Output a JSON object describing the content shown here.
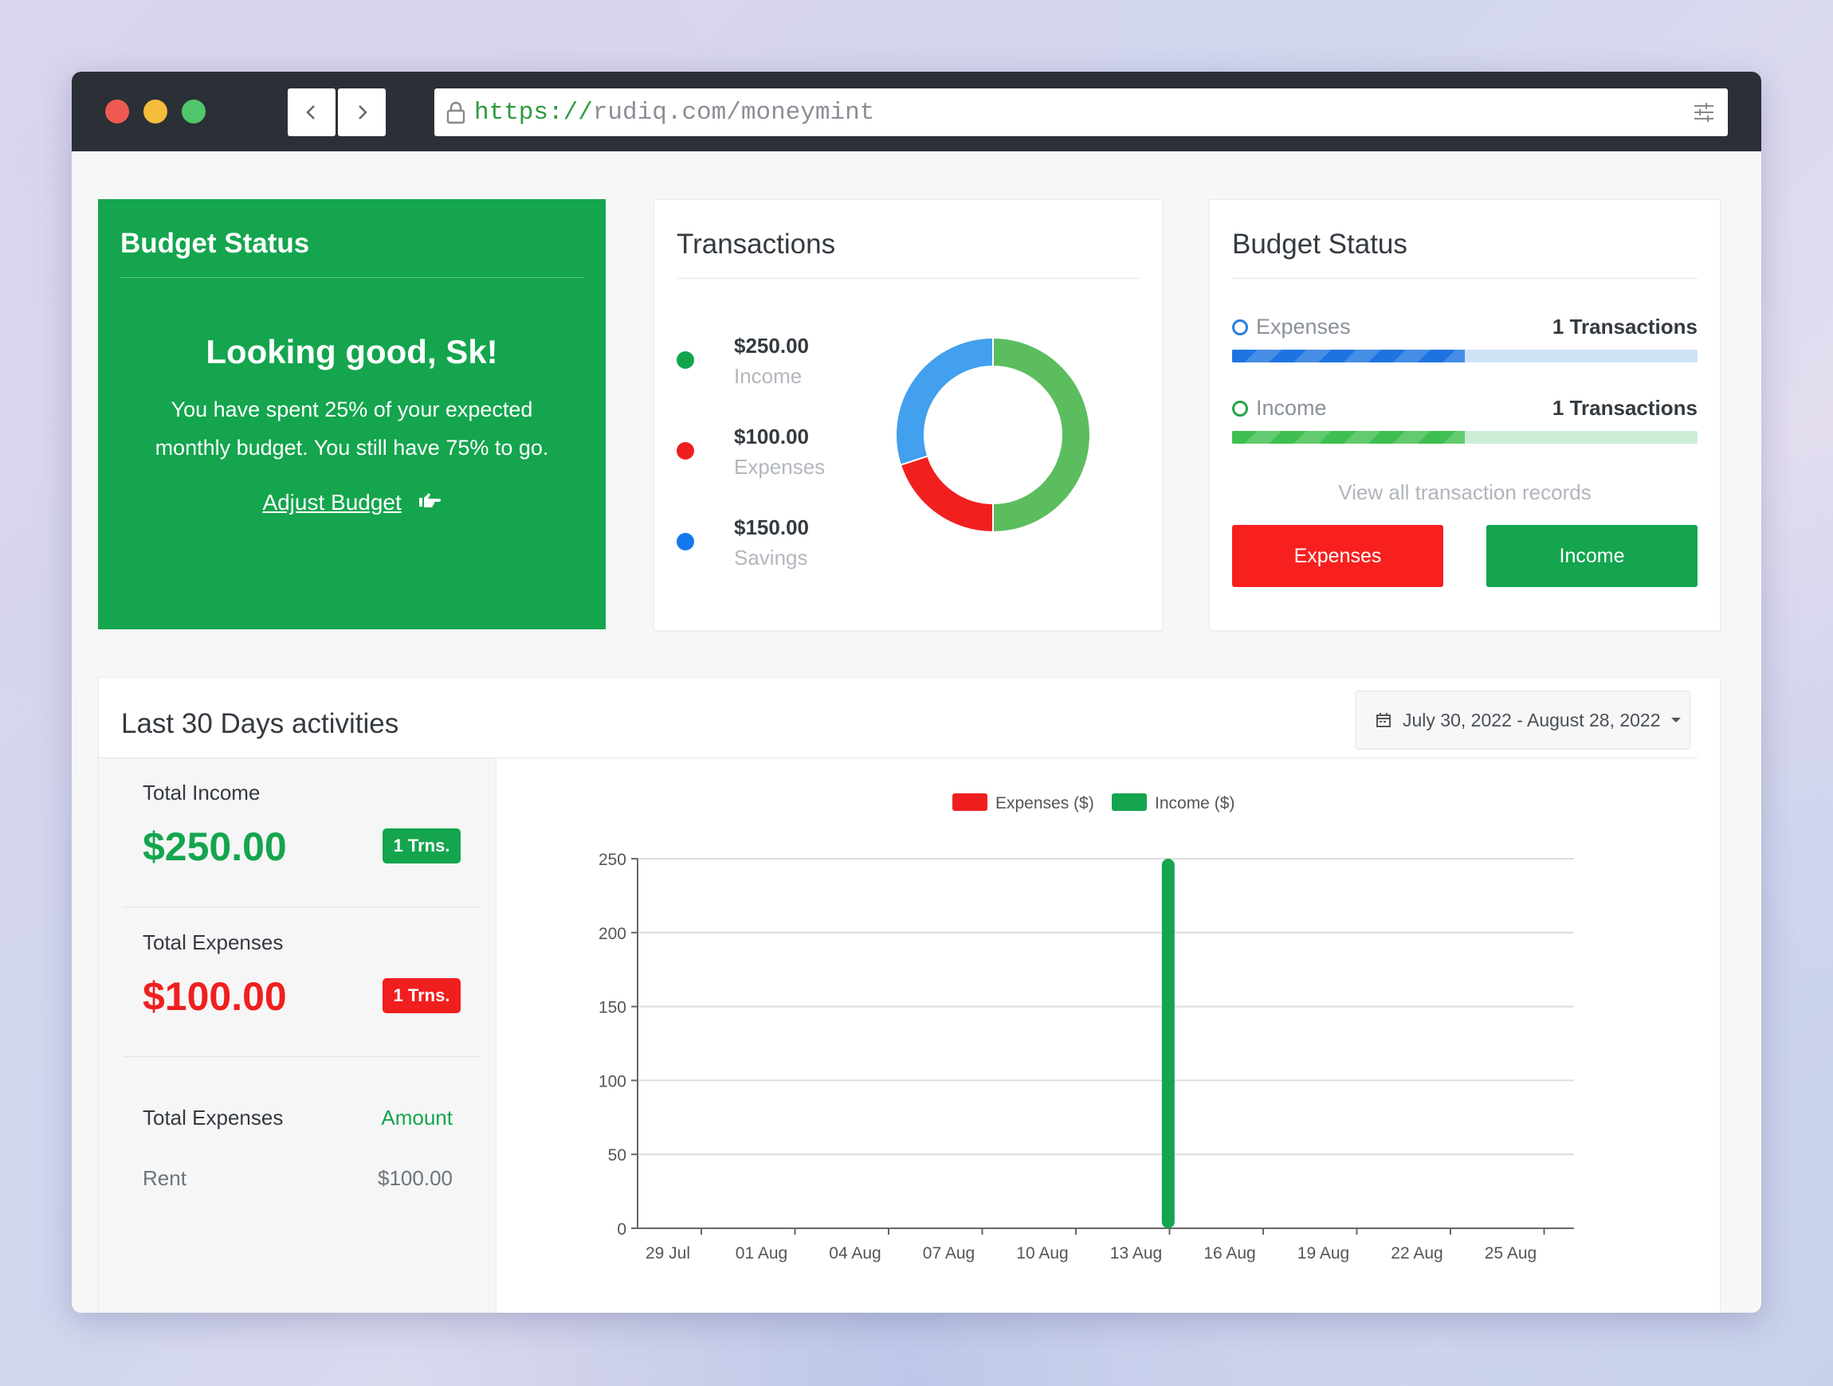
{
  "browser": {
    "url_scheme": "https://",
    "url_rest": "rudiq.com/moneymint",
    "dot_colors": [
      "#ee5a52",
      "#f5bd3c",
      "#4fc76a"
    ]
  },
  "budget_card": {
    "title": "Budget Status",
    "headline": "Looking good, Sk!",
    "message": "You have spent 25% of your expected monthly budget. You still have 75% to go.",
    "link_label": "Adjust Budget",
    "link_icon": "hand-pointing-icon",
    "color": "#14a54e"
  },
  "transactions_card": {
    "title": "Transactions",
    "items": [
      {
        "amount": "$250.00",
        "label": "Income",
        "color": "#13a54e"
      },
      {
        "amount": "$100.00",
        "label": "Expenses",
        "color": "#f01f1f"
      },
      {
        "amount": "$150.00",
        "label": "Savings",
        "color": "#1478f0"
      }
    ],
    "donut": [
      {
        "name": "Income",
        "value": 250,
        "color": "#5cbd5e"
      },
      {
        "name": "Expenses",
        "value": 100,
        "color": "#f21f1f"
      },
      {
        "name": "Savings",
        "value": 150,
        "color": "#42a0ee"
      }
    ]
  },
  "budget_status_card": {
    "title": "Budget Status",
    "rows": [
      {
        "label": "Expenses",
        "count": "1 Transactions",
        "progress": 0.5,
        "fill": "#1d74e0",
        "track": "#cfe3f7",
        "ring": "#2a7fe0"
      },
      {
        "label": "Income",
        "count": "1 Transactions",
        "progress": 0.5,
        "fill": "#3fbf4f",
        "track": "#cdeed6",
        "ring": "#24a347"
      }
    ],
    "view_all_label": "View all transaction records",
    "expenses_button": "Expenses",
    "income_button": "Income",
    "expenses_color": "#f7201f",
    "income_color": "#14a54e"
  },
  "activities": {
    "title": "Last 30 Days activities",
    "date_range": "July 30, 2022 - August 28, 2022",
    "total_income_label": "Total Income",
    "total_income_value": "$250.00",
    "total_income_badge": "1 Trns.",
    "total_expenses_label": "Total Expenses",
    "total_expenses_value": "$100.00",
    "total_expenses_badge": "1 Trns.",
    "table": {
      "header_left": "Total Expenses",
      "header_right": "Amount",
      "rows": [
        {
          "name": "Rent",
          "amount": "$100.00"
        }
      ]
    },
    "income_color": "#14a54e",
    "expenses_color": "#f01f1f"
  },
  "chart_data": {
    "type": "bar",
    "x_ticks": [
      "29 Jul",
      "01 Aug",
      "04 Aug",
      "07 Aug",
      "10 Aug",
      "13 Aug",
      "16 Aug",
      "19 Aug",
      "22 Aug",
      "25 Aug"
    ],
    "x_range": [
      "2022-07-29",
      "2022-08-28"
    ],
    "series": [
      {
        "name": "Expenses ($)",
        "color": "#f01f1f",
        "points": []
      },
      {
        "name": "Income ($)",
        "color": "#14a54e",
        "points": [
          {
            "date": "2022-08-15",
            "value": 250
          }
        ]
      }
    ],
    "y_ticks": [
      0,
      50,
      100,
      150,
      200,
      250
    ],
    "ylim": [
      0,
      250
    ],
    "grid": true,
    "legend": "top-center"
  }
}
